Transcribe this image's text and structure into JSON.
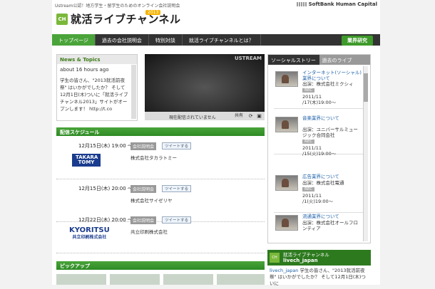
{
  "header": {
    "tagline": "Ustream公認！地方学生・留学生のためのオンライン会社説明会",
    "brand": "SoftBank Human Capital",
    "logo_text": "就活ライブチャンネル",
    "logo_badge": "CH",
    "logo_year": "2013"
  },
  "nav": {
    "items": [
      "トップページ",
      "過去の会社説明会",
      "特別対談",
      "就活ライブチャンネルとは？"
    ],
    "biz_label": "業界研究"
  },
  "news": {
    "title": "News & Topics",
    "time": "about 16 hours ago",
    "text": "学生の皆さん、\"2013就活前夜祭\" はいかがでしたか？ そして12月1日(木)ついに「就活ライブチャンネル2013」サイトがオープンします！ http://t.co"
  },
  "video": {
    "brand": "USTREAM",
    "status": "現在配信されていません",
    "share_label": "共有"
  },
  "schedule": {
    "title": "配信スケジュール",
    "events": [
      {
        "date": "12月15日(木) 19:00 〜",
        "badge": "会社説明会",
        "tweet": "ツイートする",
        "company": "株式会社タカラトミー",
        "logo": "TAKARA TOMY"
      },
      {
        "date": "12月15日(木) 20:00 〜",
        "badge": "会社説明会",
        "tweet": "ツイートする",
        "company": "株式会社サイゼリヤ",
        "logo": ""
      },
      {
        "date": "12月22日(木) 20:00 〜",
        "badge": "会社説明会",
        "tweet": "ツイートする",
        "company": "共立印刷株式会社",
        "logo": "KYORITSU",
        "logo_sub": "共立印刷株式会社"
      }
    ]
  },
  "pickup": {
    "title": "ピックアップ"
  },
  "sidebar": {
    "tab_social": "ソーシャルストリーム",
    "tab_past": "過去のライブ",
    "items": [
      {
        "title": "インターネット(ソーシャル)業界について",
        "sub": "出演：株式会社ミクシィ",
        "rec": "REC",
        "date": "2011/11\n/17(木)19:00〜"
      },
      {
        "title": "音楽業界について",
        "sub": "出演：ユニバーサルミュージック合同会社",
        "rec": "REC",
        "date": "2011/11\n/15(火)19:00〜"
      },
      {
        "title": "広告業界について",
        "sub": "出演：株式会社電通",
        "rec": "REC",
        "date": "2011/11\n/1(火)19:00〜"
      },
      {
        "title": "流通業界について",
        "sub": "出演：株式会社オールフロンティア",
        "rec": "",
        "date": ""
      }
    ]
  },
  "twitter": {
    "name": "就活ライブチャンネル",
    "handle": "livech_japan",
    "text_handle": "livech_japan",
    "text": " 学生の皆さん、\"2013就活前夜祭\" はいかがでしたか？ そして12月1日(木)ついに"
  },
  "colors": {
    "accent": "#4aa43a",
    "nav_bg": "#333333",
    "link": "#1b5fa8"
  }
}
